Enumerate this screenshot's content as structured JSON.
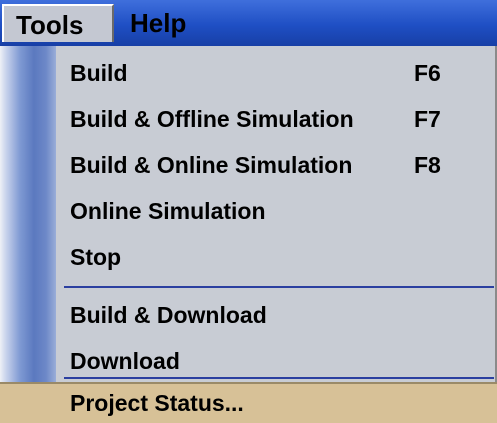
{
  "menubar": {
    "tools_label": "Tools",
    "help_label": "Help"
  },
  "tools_menu": {
    "items": [
      {
        "label": "Build",
        "shortcut": "F6"
      },
      {
        "label": "Build & Offline Simulation",
        "shortcut": "F7"
      },
      {
        "label": "Build & Online Simulation",
        "shortcut": "F8"
      },
      {
        "label": "Online Simulation",
        "shortcut": ""
      },
      {
        "label": "Stop",
        "shortcut": ""
      },
      {
        "label": "Build & Download",
        "shortcut": ""
      },
      {
        "label": "Download",
        "shortcut": ""
      },
      {
        "label": "Project Status...",
        "shortcut": ""
      }
    ],
    "highlighted_item": "Project Status..."
  },
  "colors": {
    "menubar": "#1f4fc4",
    "menu_background": "#c8ccd4",
    "highlight": "#d7c197",
    "separator": "#2b3fa0"
  }
}
